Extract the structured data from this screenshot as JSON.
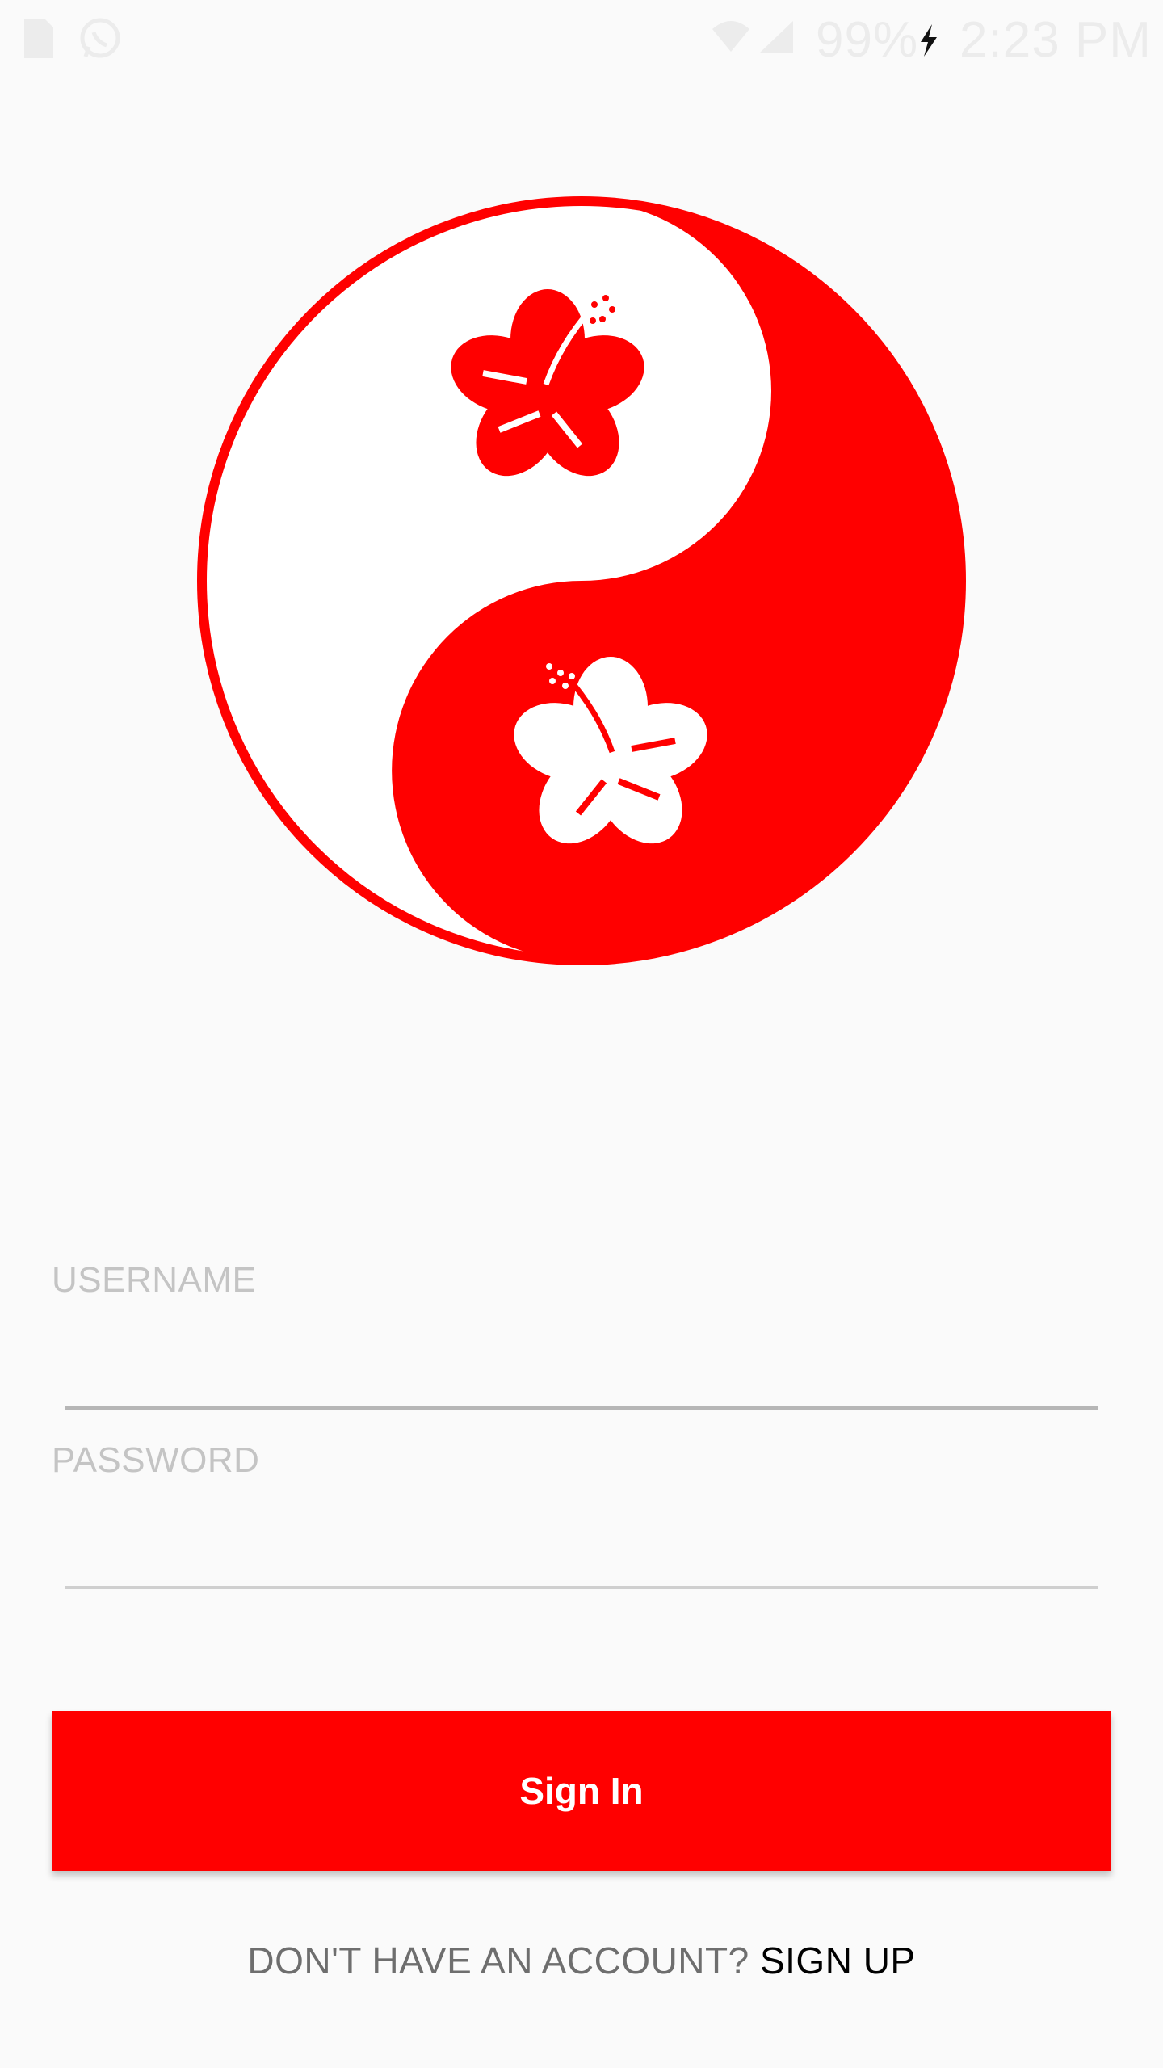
{
  "status_bar": {
    "battery_percent": "99%",
    "time": "2:23 PM",
    "icons": [
      "sim-card-icon",
      "whatsapp-icon",
      "wifi-icon",
      "signal-icon",
      "charging-bolt-icon"
    ]
  },
  "logo": {
    "icon": "yin-yang-hibiscus-logo",
    "colors": {
      "red": "#ff0000",
      "white": "#ffffff"
    }
  },
  "form": {
    "username": {
      "placeholder": "USERNAME",
      "value": ""
    },
    "password": {
      "placeholder": "PASSWORD",
      "value": ""
    }
  },
  "sign_in_button": {
    "label": "Sign In",
    "color": "#ff0000"
  },
  "signup": {
    "prompt": "DON'T HAVE AN ACCOUNT?",
    "link": "SIGN UP"
  }
}
